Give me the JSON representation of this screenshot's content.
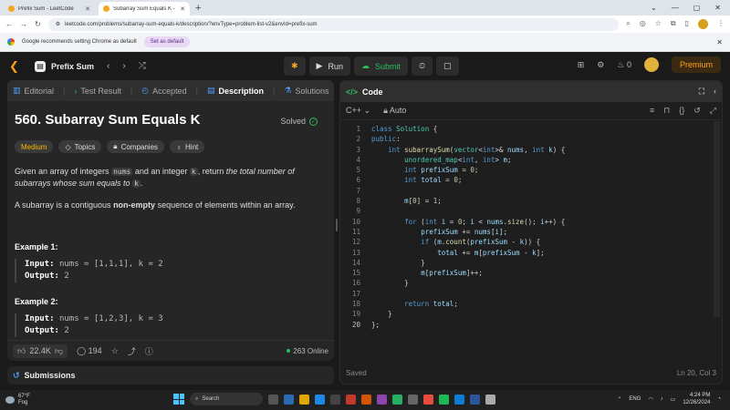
{
  "browser": {
    "tabs": [
      {
        "title": "Prefix Sum - LeetCode",
        "active": false
      },
      {
        "title": "Subarray Sum Equals K - LeetC",
        "active": true
      }
    ],
    "url": "leetcode.com/problems/subarray-sum-equals-k/description/?envType=problem-list-v2&envId=prefix-sum",
    "infobar_text": "Google recommends setting Chrome as default",
    "set_default_label": "Set as default"
  },
  "lc_header": {
    "list_title": "Prefix Sum",
    "run_label": "Run",
    "submit_label": "Submit",
    "streak_count": "0",
    "premium_label": "Premium"
  },
  "left_tabs": [
    {
      "label": "Editorial"
    },
    {
      "label": "Test Result"
    },
    {
      "label": "Accepted"
    },
    {
      "label": "Description"
    },
    {
      "label": "Solutions"
    },
    {
      "label": "Te"
    }
  ],
  "problem": {
    "title": "560. Subarray Sum Equals K",
    "status": "Solved",
    "difficulty": "Medium",
    "chip_topics": "Topics",
    "chip_companies": "Companies",
    "chip_hint": "Hint",
    "desc_p1_a": "Given an array of integers ",
    "desc_p1_code1": "nums",
    "desc_p1_b": " and an integer ",
    "desc_p1_code2": "k",
    "desc_p1_c": ", return ",
    "desc_p1_italic": "the total number of subarrays whose sum equals to",
    "desc_p1_d": " ",
    "desc_p1_code3": "k",
    "desc_p1_e": ".",
    "desc_p2_a": "A subarray is a contiguous ",
    "desc_p2_bold": "non-empty",
    "desc_p2_b": " sequence of elements within an array.",
    "examples": [
      {
        "heading": "Example 1:",
        "input_label": "Input:",
        "input": "nums = [1,1,1], k = 2",
        "output_label": "Output:",
        "output": "2"
      },
      {
        "heading": "Example 2:",
        "input_label": "Input:",
        "input": "nums = [1,2,3], k = 3",
        "output_label": "Output:",
        "output": "2"
      }
    ]
  },
  "left_footer": {
    "likes": "22.4K",
    "comments": "194",
    "online": "263 Online"
  },
  "submissions_label": "Submissions",
  "code_panel": {
    "title": "Code",
    "language": "C++",
    "mode": "Auto",
    "saved": "Saved",
    "cursor": "Ln 20, Col 3"
  },
  "taskbar": {
    "temp": "67°F",
    "weather": "Fog",
    "search": "Search",
    "lang": "ENG",
    "time": "4:24 PM",
    "date": "12/26/2024"
  },
  "colors": {
    "accent_green": "#2cbb5d",
    "medium_yellow": "#ffb800",
    "leetcode_orange": "#ffa116",
    "panel_bg": "#262626"
  }
}
